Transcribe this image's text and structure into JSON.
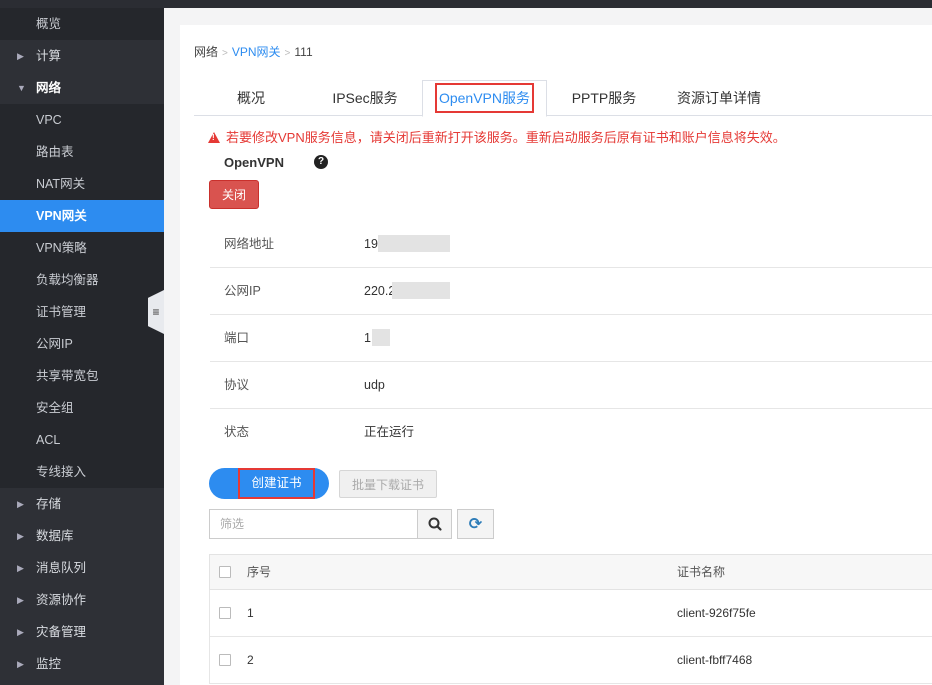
{
  "sidebar": {
    "top_item": "概览",
    "compute": "计算",
    "network": "网络",
    "network_items": [
      "VPC",
      "路由表",
      "NAT网关",
      "VPN网关",
      "VPN策略",
      "负载均衡器",
      "证书管理",
      "公网IP",
      "共享带宽包",
      "安全组",
      "ACL",
      "专线接入"
    ],
    "active_item": "VPN网关",
    "groups_after": [
      "存储",
      "数据库",
      "消息队列",
      "资源协作",
      "灾备管理",
      "监控"
    ]
  },
  "breadcrumb": {
    "root": "网络",
    "parent": "VPN网关",
    "current": "111"
  },
  "tabs": [
    "概况",
    "IPSec服务",
    "OpenVPN服务",
    "PPTP服务",
    "资源订单详情"
  ],
  "active_tab": "OpenVPN服务",
  "warning": "若要修改VPN服务信息，请关闭后重新打开该服务。重新启动服务后原有证书和账户信息将失效。",
  "service_title": "OpenVPN",
  "close_button": "关闭",
  "info": [
    {
      "label": "网络地址",
      "value": "19"
    },
    {
      "label": "公网IP",
      "value": "220.2"
    },
    {
      "label": "端口",
      "value": "1"
    },
    {
      "label": "协议",
      "value": "udp"
    },
    {
      "label": "状态",
      "value": "正在运行"
    }
  ],
  "create_button": "创建证书",
  "batch_download_button": "批量下载证书",
  "filter_placeholder": "筛选",
  "table": {
    "headers": [
      "序号",
      "证书名称"
    ],
    "rows": [
      {
        "index": "1",
        "name": "client-926f75fe"
      },
      {
        "index": "2",
        "name": "client-fbff7468"
      }
    ]
  },
  "colors": {
    "accent": "#2d8cf0",
    "danger": "#d9534f",
    "warning_text": "#e53935",
    "sidebar_bg": "#2e3036"
  }
}
